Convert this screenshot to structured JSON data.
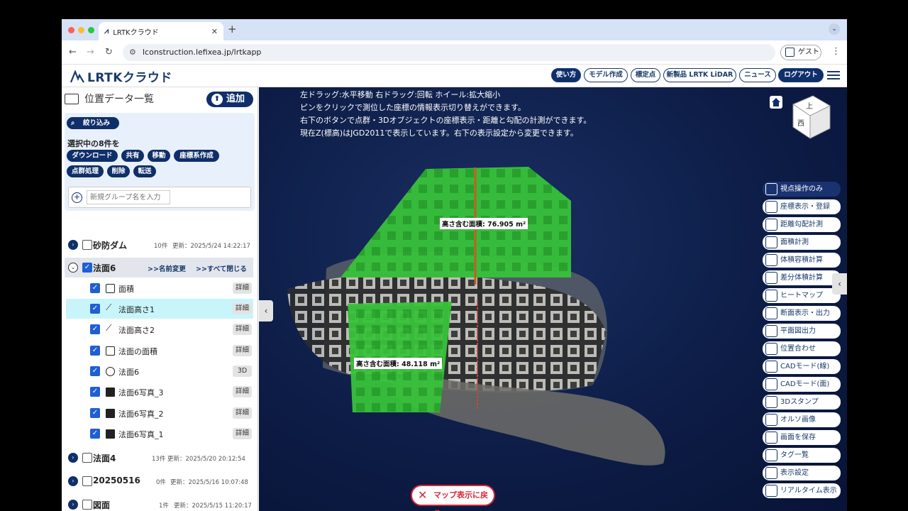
{
  "browser": {
    "tab_title": "LRTKクラウド",
    "url": "lconstruction.lefixea.jp/lrtkapp",
    "guest_label": "ゲスト"
  },
  "header": {
    "brand": "LRTKクラウド",
    "buttons": [
      "使い方",
      "モデル作成",
      "標定点",
      "新製品 LRTK LiDAR",
      "ニュース",
      "ログアウト"
    ]
  },
  "sidebar": {
    "title": "位置データ一覧",
    "add_label": "追加",
    "filter_label": "絞り込み",
    "selected_label": "選択中の8件を",
    "actions_row1": [
      "ダウンロード",
      "共有",
      "移動",
      "座標系作成"
    ],
    "actions_row2": [
      "点群処理",
      "削除",
      "転送"
    ],
    "group_placeholder": "新規グループ名を入力",
    "groups": [
      {
        "name": "砂防ダム",
        "count": "10件",
        "updated": "更新：2025/5/24 14:22:17"
      },
      {
        "name": "法面6",
        "rename": ">>名前変更",
        "close_all": ">>すべて閉じる"
      },
      {
        "name": "法面4",
        "count": "13件",
        "updated": "更新：2025/5/20 20:12:54"
      },
      {
        "name": "20250516",
        "count": "0件",
        "updated": "更新：2025/5/16 10:07:48"
      },
      {
        "name": "図面",
        "count": "1件",
        "updated": "更新：2025/5/15 11:20:17"
      }
    ],
    "items": [
      {
        "name": "面積",
        "icon": "area-icon",
        "action": "詳細"
      },
      {
        "name": "法面高さ1",
        "icon": "line-measure-icon",
        "action": "詳細"
      },
      {
        "name": "法面高さ2",
        "icon": "line-measure-icon",
        "action": "詳細"
      },
      {
        "name": "法面の面積",
        "icon": "area-icon",
        "action": "詳細"
      },
      {
        "name": "法面6",
        "icon": "pointcloud-icon",
        "action": "3D"
      },
      {
        "name": "法面6写真_3",
        "icon": "photo-icon",
        "action": "詳細"
      },
      {
        "name": "法面6写真_2",
        "icon": "photo-icon",
        "action": "詳細"
      },
      {
        "name": "法面6写真_1",
        "icon": "photo-icon",
        "action": "詳細"
      }
    ]
  },
  "viewer": {
    "instructions": [
      "左ドラッグ:水平移動 右ドラッグ:回転 ホイール:拡大縮小",
      "ピンをクリックで測位した座標の情報表示切り替えができます。",
      "右下のボタンで点群・3Dオブジェクトの座標表示・距離と勾配の計測ができます。",
      "現在Z(標高)はJGD2011で表示しています。右下の表示設定から変更できます。"
    ],
    "cube_labels": [
      "上",
      "西"
    ],
    "area_labels": [
      "高さ含む面積: 76.905 m²",
      "高さ含む面積: 48.118 m²"
    ],
    "back_to_map": "マップ表示に戻る",
    "tools": [
      "視点操作のみ",
      "座標表示・登録",
      "距離勾配計測",
      "面積計測",
      "体積容積計算",
      "差分体積計算",
      "ヒートマップ",
      "断面表示・出力",
      "平面図出力",
      "位置合わせ",
      "CADモード(線)",
      "CADモード(面)",
      "3Dスタンプ",
      "オルソ画像",
      "画面を保存",
      "タグ一覧",
      "表示設定",
      "リアルタイム表示"
    ]
  }
}
